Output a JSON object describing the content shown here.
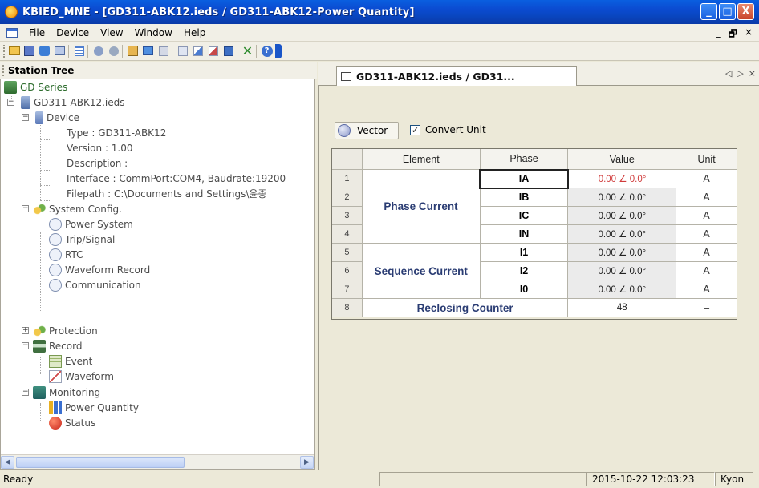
{
  "window": {
    "title": "KBIED_MNE - [GD311-ABK12.ieds / GD311-ABK12-Power Quantity]",
    "minimize": "_",
    "maximize": "□",
    "close": "X"
  },
  "menu": {
    "items": [
      {
        "label": "File"
      },
      {
        "label": "Device"
      },
      {
        "label": "View"
      },
      {
        "label": "Window"
      },
      {
        "label": "Help"
      }
    ],
    "mdi_min": "_",
    "mdi_restore": "🗗",
    "mdi_close": "×"
  },
  "toolbar": {
    "buttons": [
      "open",
      "save",
      "connect",
      "device",
      "list",
      "import",
      "export",
      "settings",
      "monitor",
      "view",
      "window",
      "tool",
      "tool2",
      "download",
      "close-x",
      "help"
    ]
  },
  "left_pane": {
    "title": "Station Tree",
    "tree": {
      "root": "GD Series",
      "file": "GD311-ABK12.ieds",
      "device": {
        "label": "Device",
        "type": "Type : GD311-ABK12",
        "version": "Version : 1.00",
        "description": "Description :",
        "interface": "Interface : CommPort:COM4, Baudrate:19200",
        "filepath": "Filepath : C:\\Documents and Settings\\윤종"
      },
      "system_config": {
        "label": "System Config.",
        "children": [
          "Power System",
          "Trip/Signal",
          "RTC",
          "Waveform Record",
          "Communication"
        ]
      },
      "protection": "Protection",
      "record": {
        "label": "Record",
        "children": [
          "Event",
          "Waveform"
        ]
      },
      "monitoring": {
        "label": "Monitoring",
        "children": [
          "Power Quantity",
          "Status"
        ]
      }
    }
  },
  "document": {
    "tab_title": "GD311-ABK12.ieds / GD31...",
    "tab_nav": "◁ ▷ ×",
    "vector_label": "Vector",
    "convert_unit_label": "Convert Unit",
    "convert_unit_checked": true,
    "table": {
      "headers": [
        "Element",
        "Phase",
        "Value",
        "Unit"
      ],
      "rows": [
        {
          "n": "1",
          "phase": "IA",
          "value": "0.00 ∠ 0.0°",
          "unit": "A"
        },
        {
          "n": "2",
          "phase": "IB",
          "value": "0.00 ∠ 0.0°",
          "unit": "A"
        },
        {
          "n": "3",
          "phase": "IC",
          "value": "0.00 ∠ 0.0°",
          "unit": "A"
        },
        {
          "n": "4",
          "phase": "IN",
          "value": "0.00 ∠ 0.0°",
          "unit": "A"
        },
        {
          "n": "5",
          "phase": "I1",
          "value": "0.00 ∠ 0.0°",
          "unit": "A"
        },
        {
          "n": "6",
          "phase": "I2",
          "value": "0.00 ∠ 0.0°",
          "unit": "A"
        },
        {
          "n": "7",
          "phase": "I0",
          "value": "0.00 ∠ 0.0°",
          "unit": "A"
        },
        {
          "n": "8",
          "phase": "",
          "value": "48",
          "unit": "–"
        }
      ],
      "groups": {
        "phase_current": "Phase Current",
        "sequence_current": "Sequence Current",
        "reclosing_counter": "Reclosing Counter"
      }
    }
  },
  "statusbar": {
    "ready": "Ready",
    "datetime": "2015-10-22 12:03:23",
    "user": "Kyon"
  },
  "colors": {
    "title_bar": "#0a4fd8",
    "element_text": "#2a3c73",
    "selected_value_text": "#d03b3b"
  }
}
